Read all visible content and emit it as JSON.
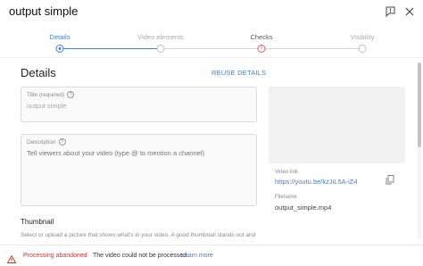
{
  "dialog": {
    "title": "output simple",
    "icons": [
      "feedback-icon",
      "close-icon"
    ]
  },
  "stepper": {
    "steps": [
      {
        "label": "Details",
        "state": "active"
      },
      {
        "label": "Video elements",
        "state": "pending"
      },
      {
        "label": "Checks",
        "state": "warning",
        "badge": "!"
      },
      {
        "label": "Visibility",
        "state": "pending"
      }
    ]
  },
  "details": {
    "heading": "Details",
    "reuse_label": "REUSE DETAILS",
    "title_field": {
      "label": "Title (required)",
      "help": "?",
      "value": "output simple"
    },
    "description_field": {
      "label": "Description",
      "help": "?",
      "placeholder": "Tell viewers about your video (type @ to mention a channel)"
    },
    "thumbnail": {
      "heading": "Thumbnail",
      "description": "Select or upload a picture that shows what's in your video. A good thumbnail stands out and"
    }
  },
  "preview": {
    "video_link_label": "Video link",
    "video_link": "https://youtu.be/kzJiL5A-iZ4",
    "filename_label": "Filename",
    "filename": "output_simple.mp4"
  },
  "footer": {
    "status": "Processing abandoned",
    "message": "The video could not be processed.",
    "link": "Learn more"
  },
  "colors": {
    "accent": "#3f7fd8",
    "error": "#d93025"
  }
}
